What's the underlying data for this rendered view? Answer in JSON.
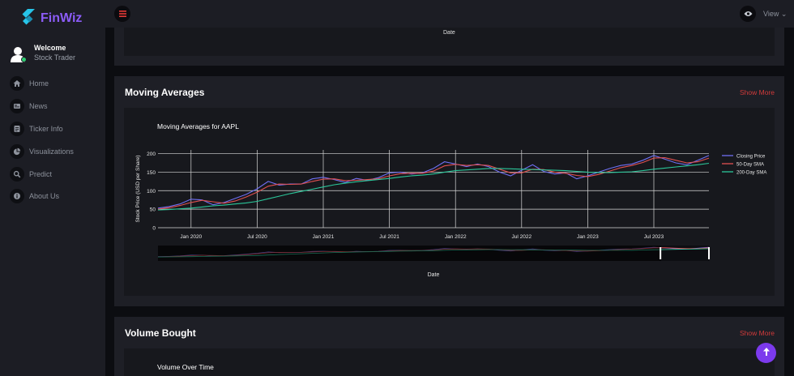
{
  "app": {
    "name": "FinWiz",
    "accent": "#8b5cf6"
  },
  "user": {
    "welcome": "Welcome",
    "role": "Stock Trader"
  },
  "nav": [
    {
      "label": "Home",
      "icon": "home-icon"
    },
    {
      "label": "News",
      "icon": "news-icon"
    },
    {
      "label": "Ticker Info",
      "icon": "ticker-icon"
    },
    {
      "label": "Visualizations",
      "icon": "pie-chart-icon"
    },
    {
      "label": "Predict",
      "icon": "search-icon"
    },
    {
      "label": "About Us",
      "icon": "info-icon"
    }
  ],
  "topbar": {
    "view_label": "View"
  },
  "prev_section": {
    "date_label": "Date"
  },
  "moving_averages": {
    "title": "Moving Averages",
    "show_more": "Show More",
    "chart_data": {
      "type": "line",
      "title": "Moving Averages for AAPL",
      "xlabel": "Date",
      "ylabel": "Stock Price (USD per Share)",
      "ylim": [
        0,
        210
      ],
      "yticks": [
        0,
        50,
        100,
        150,
        200
      ],
      "xticks": [
        "Jan 2020",
        "Jul 2020",
        "Jan 2021",
        "Jul 2021",
        "Jan 2022",
        "Jul 2022",
        "Jan 2023",
        "Jul 2023"
      ],
      "grid": true,
      "legend_position": "top-right",
      "range_slider": true,
      "x": [
        "2019-10",
        "2019-11",
        "2019-12",
        "2020-01",
        "2020-02",
        "2020-03",
        "2020-04",
        "2020-05",
        "2020-06",
        "2020-07",
        "2020-08",
        "2020-09",
        "2020-10",
        "2020-11",
        "2020-12",
        "2021-01",
        "2021-02",
        "2021-03",
        "2021-04",
        "2021-05",
        "2021-06",
        "2021-07",
        "2021-08",
        "2021-09",
        "2021-10",
        "2021-11",
        "2021-12",
        "2022-01",
        "2022-02",
        "2022-03",
        "2022-04",
        "2022-05",
        "2022-06",
        "2022-07",
        "2022-08",
        "2022-09",
        "2022-10",
        "2022-11",
        "2022-12",
        "2023-01",
        "2023-02",
        "2023-03",
        "2023-04",
        "2023-05",
        "2023-06",
        "2023-07",
        "2023-08",
        "2023-09",
        "2023-10",
        "2023-11",
        "2023-12"
      ],
      "series": [
        {
          "name": "Closing Price",
          "color": "#6f6ff2",
          "values": [
            53,
            57,
            64,
            77,
            75,
            62,
            68,
            79,
            90,
            105,
            125,
            115,
            118,
            118,
            132,
            136,
            130,
            122,
            133,
            128,
            135,
            148,
            150,
            145,
            148,
            160,
            178,
            172,
            165,
            172,
            165,
            150,
            140,
            155,
            170,
            152,
            145,
            148,
            132,
            140,
            150,
            160,
            168,
            172,
            182,
            195,
            185,
            175,
            170,
            182,
            195
          ]
        },
        {
          "name": "50-Day SMA",
          "color": "#e05050",
          "values": [
            50,
            54,
            60,
            68,
            74,
            70,
            66,
            72,
            83,
            96,
            112,
            118,
            117,
            118,
            125,
            131,
            132,
            127,
            128,
            130,
            132,
            140,
            146,
            147,
            147,
            153,
            167,
            171,
            168,
            170,
            168,
            158,
            148,
            148,
            158,
            157,
            150,
            147,
            141,
            138,
            144,
            153,
            162,
            168,
            176,
            188,
            189,
            182,
            175,
            178,
            188
          ]
        },
        {
          "name": "200-Day SMA",
          "color": "#2bc79a",
          "values": [
            48,
            49,
            51,
            53,
            56,
            59,
            61,
            64,
            67,
            71,
            78,
            85,
            92,
            98,
            104,
            110,
            116,
            120,
            124,
            127,
            130,
            133,
            137,
            140,
            142,
            145,
            150,
            154,
            156,
            158,
            160,
            160,
            159,
            158,
            157,
            156,
            155,
            154,
            152,
            150,
            149,
            149,
            150,
            151,
            154,
            158,
            161,
            164,
            167,
            170,
            174
          ]
        }
      ]
    }
  },
  "volume_bought": {
    "title": "Volume Bought",
    "show_more": "Show More",
    "chart_title": "Volume Over Time"
  }
}
